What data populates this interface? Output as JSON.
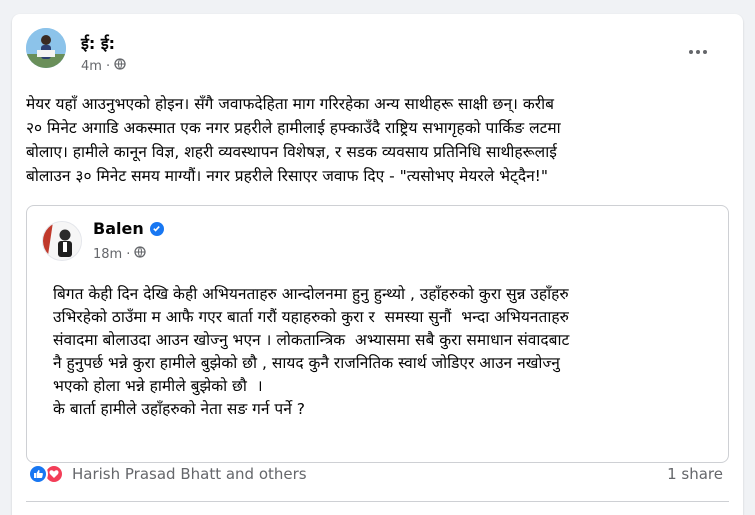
{
  "post": {
    "author": "ई: ई:",
    "time": "4m",
    "privacy_icon": "globe-icon",
    "text": "मेयर यहाँ आउनुभएको होइन। सँगै जवाफदेहिता माग गरिरहेका अन्य साथीहरू साक्षी छन्। करीब\n२० मिनेट अगाडि अकस्मात एक नगर प्रहरीले हामीलाई हफ्काउँदै राष्ट्रिय सभागृहको पार्किङ लटमा\nबोलाए। हामीले कानून विज्ञ, शहरी व्यवस्थापन विशेषज्ञ, र सडक व्यवसाय प्रतिनिधि साथीहरूलाई\nबोलाउन ३० मिनेट समय माग्यौं। नगर प्रहरीले रिसाएर जवाफ दिए - \"त्यसोभए मेयरले भेट्दैन!\""
  },
  "shared_post": {
    "author": "Balen",
    "verified": true,
    "time": "18m",
    "privacy_icon": "globe-icon",
    "text": "बिगत केही दिन देखि केही अभियनताहरु आन्दोलनमा हुनु हुन्थ्यो , उहाँहरुको कुरा सुन्न उहाँहरु\nउभिरहेको ठाउँमा म आफै गएर बार्ता गरौं यहाहरुको कुरा र  समस्या सुनौं  भन्दा अभियनताहरु\nसंवादमा बोलाउदा आउन खोज्नु भएन । लोकतान्त्रिक  अभ्यासमा सबै कुरा समाधान संवादबाट\nनै हुनुपर्छ भन्ने कुरा हामीले बुझेको छौ , सायद कुनै राजनितिक स्वार्थ जोडिएर आउन नखोज्नु\nभएको होला भन्ने हामीले बुझेको छौ  ।\nके बार्ता हामीले उहाँहरुको नेता सङ गर्न पर्ने ?"
  },
  "footer": {
    "reactions": [
      "like-icon",
      "love-icon"
    ],
    "reaction_names": "Harish Prasad Bhatt and others",
    "shares": "1 share"
  },
  "colors": {
    "accent": "#1877f2",
    "love": "#f33e58",
    "secondary_text": "#65676b",
    "background": "#f0f2f5"
  }
}
